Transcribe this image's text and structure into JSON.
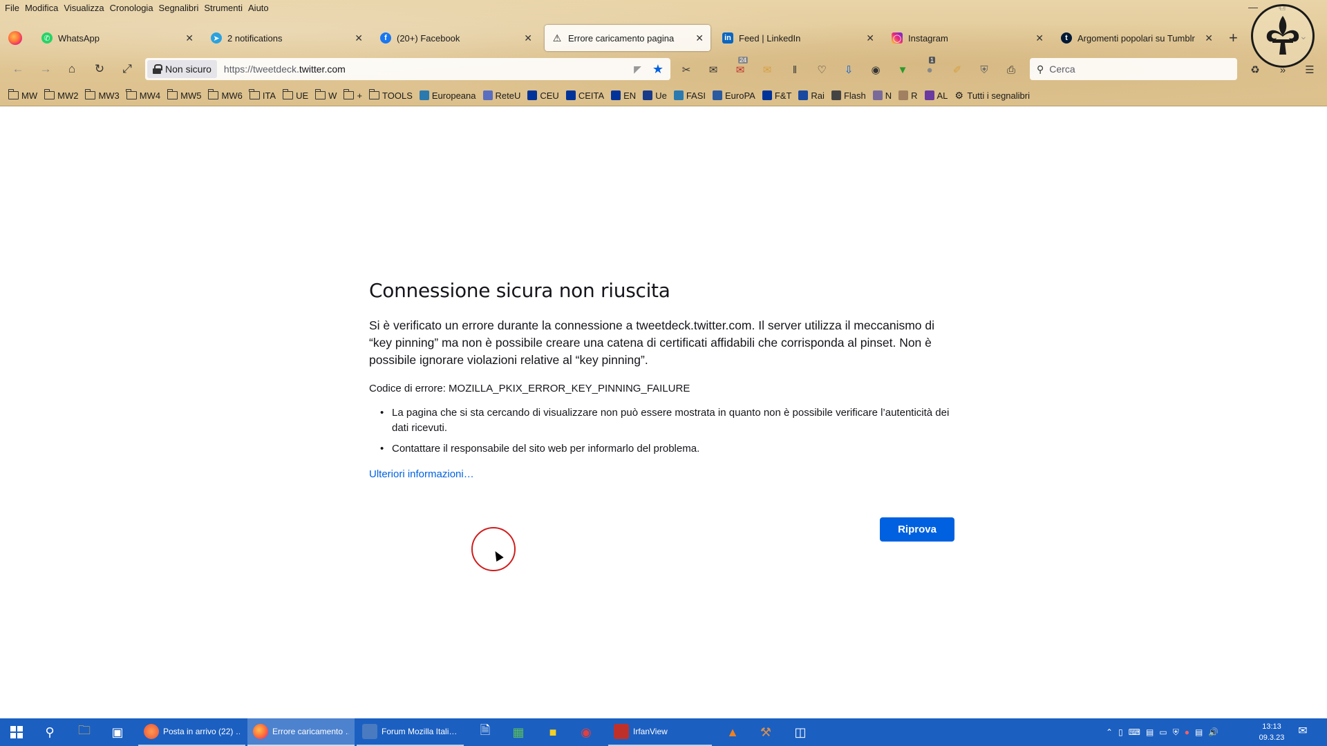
{
  "menubar": {
    "items": [
      "File",
      "Modifica",
      "Visualizza",
      "Cronologia",
      "Segnalibri",
      "Strumenti",
      "Aiuto"
    ]
  },
  "tabs": [
    {
      "label": "WhatsApp",
      "icon": "whatsapp-icon",
      "color": "#25d366",
      "active": false
    },
    {
      "label": "2 notifications",
      "icon": "telegram-icon",
      "color": "#2aa2df",
      "active": false
    },
    {
      "label": "(20+) Facebook",
      "icon": "facebook-icon",
      "color": "#1877f2",
      "active": false
    },
    {
      "label": "Errore caricamento pagina",
      "icon": "warning-icon",
      "color": "#1a1a1a",
      "active": true
    },
    {
      "label": "Feed | LinkedIn",
      "icon": "linkedin-icon",
      "color": "#0a66c2",
      "active": false
    },
    {
      "label": "Instagram",
      "icon": "instagram-icon",
      "color": "#e1306c",
      "active": false
    },
    {
      "label": "Argomenti popolari su Tumblr",
      "icon": "tumblr-icon",
      "color": "#001935",
      "active": false
    }
  ],
  "urlbar": {
    "identity": "Non sicuro",
    "url_prefix": "https://tweetdeck.",
    "url_host": "twitter.com"
  },
  "searchbar": {
    "placeholder": "Cerca"
  },
  "bookmarks": [
    {
      "label": "MW",
      "type": "folder"
    },
    {
      "label": "MW2",
      "type": "folder"
    },
    {
      "label": "MW3",
      "type": "folder"
    },
    {
      "label": "MW4",
      "type": "folder"
    },
    {
      "label": "MW5",
      "type": "folder"
    },
    {
      "label": "MW6",
      "type": "folder"
    },
    {
      "label": "ITA",
      "type": "folder"
    },
    {
      "label": "UE",
      "type": "folder"
    },
    {
      "label": "W",
      "type": "folder"
    },
    {
      "label": "+",
      "type": "folder"
    },
    {
      "label": "TOOLS",
      "type": "folder"
    },
    {
      "label": "Europeana",
      "type": "site",
      "color": "#2a7ab0"
    },
    {
      "label": "ReteU",
      "type": "site",
      "color": "#5a6ec0"
    },
    {
      "label": "CEU",
      "type": "site",
      "color": "#003399"
    },
    {
      "label": "CEITA",
      "type": "site",
      "color": "#003399"
    },
    {
      "label": "EN",
      "type": "site",
      "color": "#003399"
    },
    {
      "label": "Ue",
      "type": "site",
      "color": "#1a3a8a"
    },
    {
      "label": "FASI",
      "type": "site",
      "color": "#2a7ab0"
    },
    {
      "label": "EuroPA",
      "type": "site",
      "color": "#2a5aa0"
    },
    {
      "label": "F&T",
      "type": "site",
      "color": "#003399"
    },
    {
      "label": "Rai",
      "type": "site",
      "color": "#1a4aa0"
    },
    {
      "label": "Flash",
      "type": "site",
      "color": "#444444"
    },
    {
      "label": "N",
      "type": "site",
      "color": "#7a6a9a"
    },
    {
      "label": "R",
      "type": "site",
      "color": "#a08060"
    },
    {
      "label": "AL",
      "type": "site",
      "color": "#6a3aa0"
    },
    {
      "label": "Tutti i segnalibri",
      "type": "gear"
    }
  ],
  "toolbar": {
    "mail_badge": "24",
    "addon_badge": "1"
  },
  "error": {
    "title": "Connessione sicura non riuscita",
    "description": "Si è verificato un errore durante la connessione a tweetdeck.twitter.com. Il server utilizza il meccanismo di “key pinning” ma non è possibile creare una catena di certificati affidabili che corrisponda al pinset. Non è possibile ignorare violazioni relative al “key pinning”.",
    "code": "Codice di errore: MOZILLA_PKIX_ERROR_KEY_PINNING_FAILURE",
    "bullets": [
      "La pagina che si sta cercando di visualizzare non può essere mostrata in quanto non è possibile verificare l’autenticità dei dati ricevuti.",
      "Contattare il responsabile del sito web per informarlo del problema."
    ],
    "learn_more": "Ulteriori informazioni…",
    "retry": "Riprova"
  },
  "taskbar": {
    "apps": [
      {
        "label": "Posta in arrivo (22) …",
        "icon": "thunderbird-icon",
        "color": "#e8503a",
        "active": false
      },
      {
        "label": "Errore caricamento …",
        "icon": "firefox-icon",
        "color": "#ff7139",
        "active": true
      },
      {
        "label": "Forum Mozilla Itali…",
        "icon": "seamonkey-icon",
        "color": "#4a7ac0",
        "active": false
      },
      {
        "label": "IrfanView",
        "icon": "irfanview-icon",
        "color": "#c0302a",
        "active": false
      }
    ],
    "clock_time": "13:13",
    "clock_date": "09.3.23"
  }
}
